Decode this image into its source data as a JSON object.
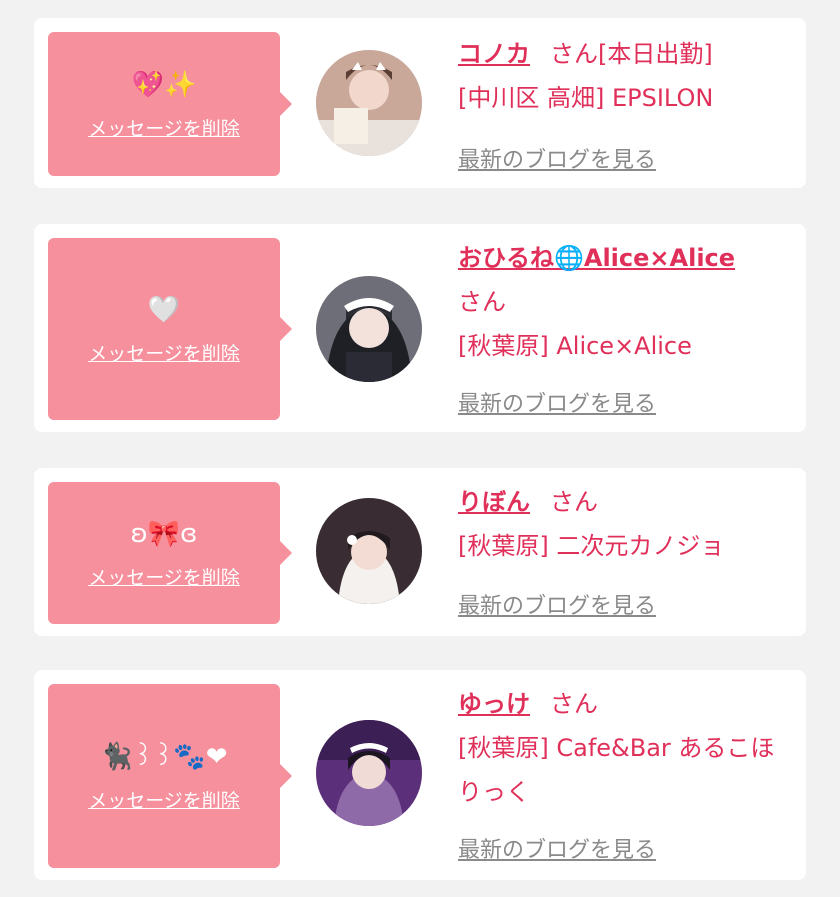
{
  "cards": [
    {
      "emoji": "💖✨",
      "delete_label": "メッセージを削除",
      "name": "コノカ",
      "suffix": "さん",
      "status": "[本日出勤]",
      "shop": "[中川区 高畑] EPSILON",
      "blog_label": "最新のブログを見る"
    },
    {
      "emoji": "🤍",
      "delete_label": "メッセージを削除",
      "name": "おひるね🌐Alice×Alice",
      "suffix": "さん",
      "status": "",
      "shop": "[秋葉原] Alice×Alice",
      "blog_label": "最新のブログを見る"
    },
    {
      "emoji": "ʚ🎀ɞ",
      "delete_label": "メッセージを削除",
      "name": "りぼん",
      "suffix": "さん",
      "status": "",
      "shop": "[秋葉原] 二次元カノジョ",
      "blog_label": "最新のブログを見る"
    },
    {
      "emoji": "🐈‍⬛꒱꒱🐾❤",
      "delete_label": "メッセージを削除",
      "name": "ゆっけ",
      "suffix": "さん",
      "status": "",
      "shop": "[秋葉原] Cafe&Bar あるこほりっく",
      "blog_label": "最新のブログを見る"
    }
  ],
  "colors": {
    "accent": "#e0305a",
    "bubble": "#f7909d",
    "link_gray": "#8a8a8a",
    "background": "#f2f2f2"
  }
}
